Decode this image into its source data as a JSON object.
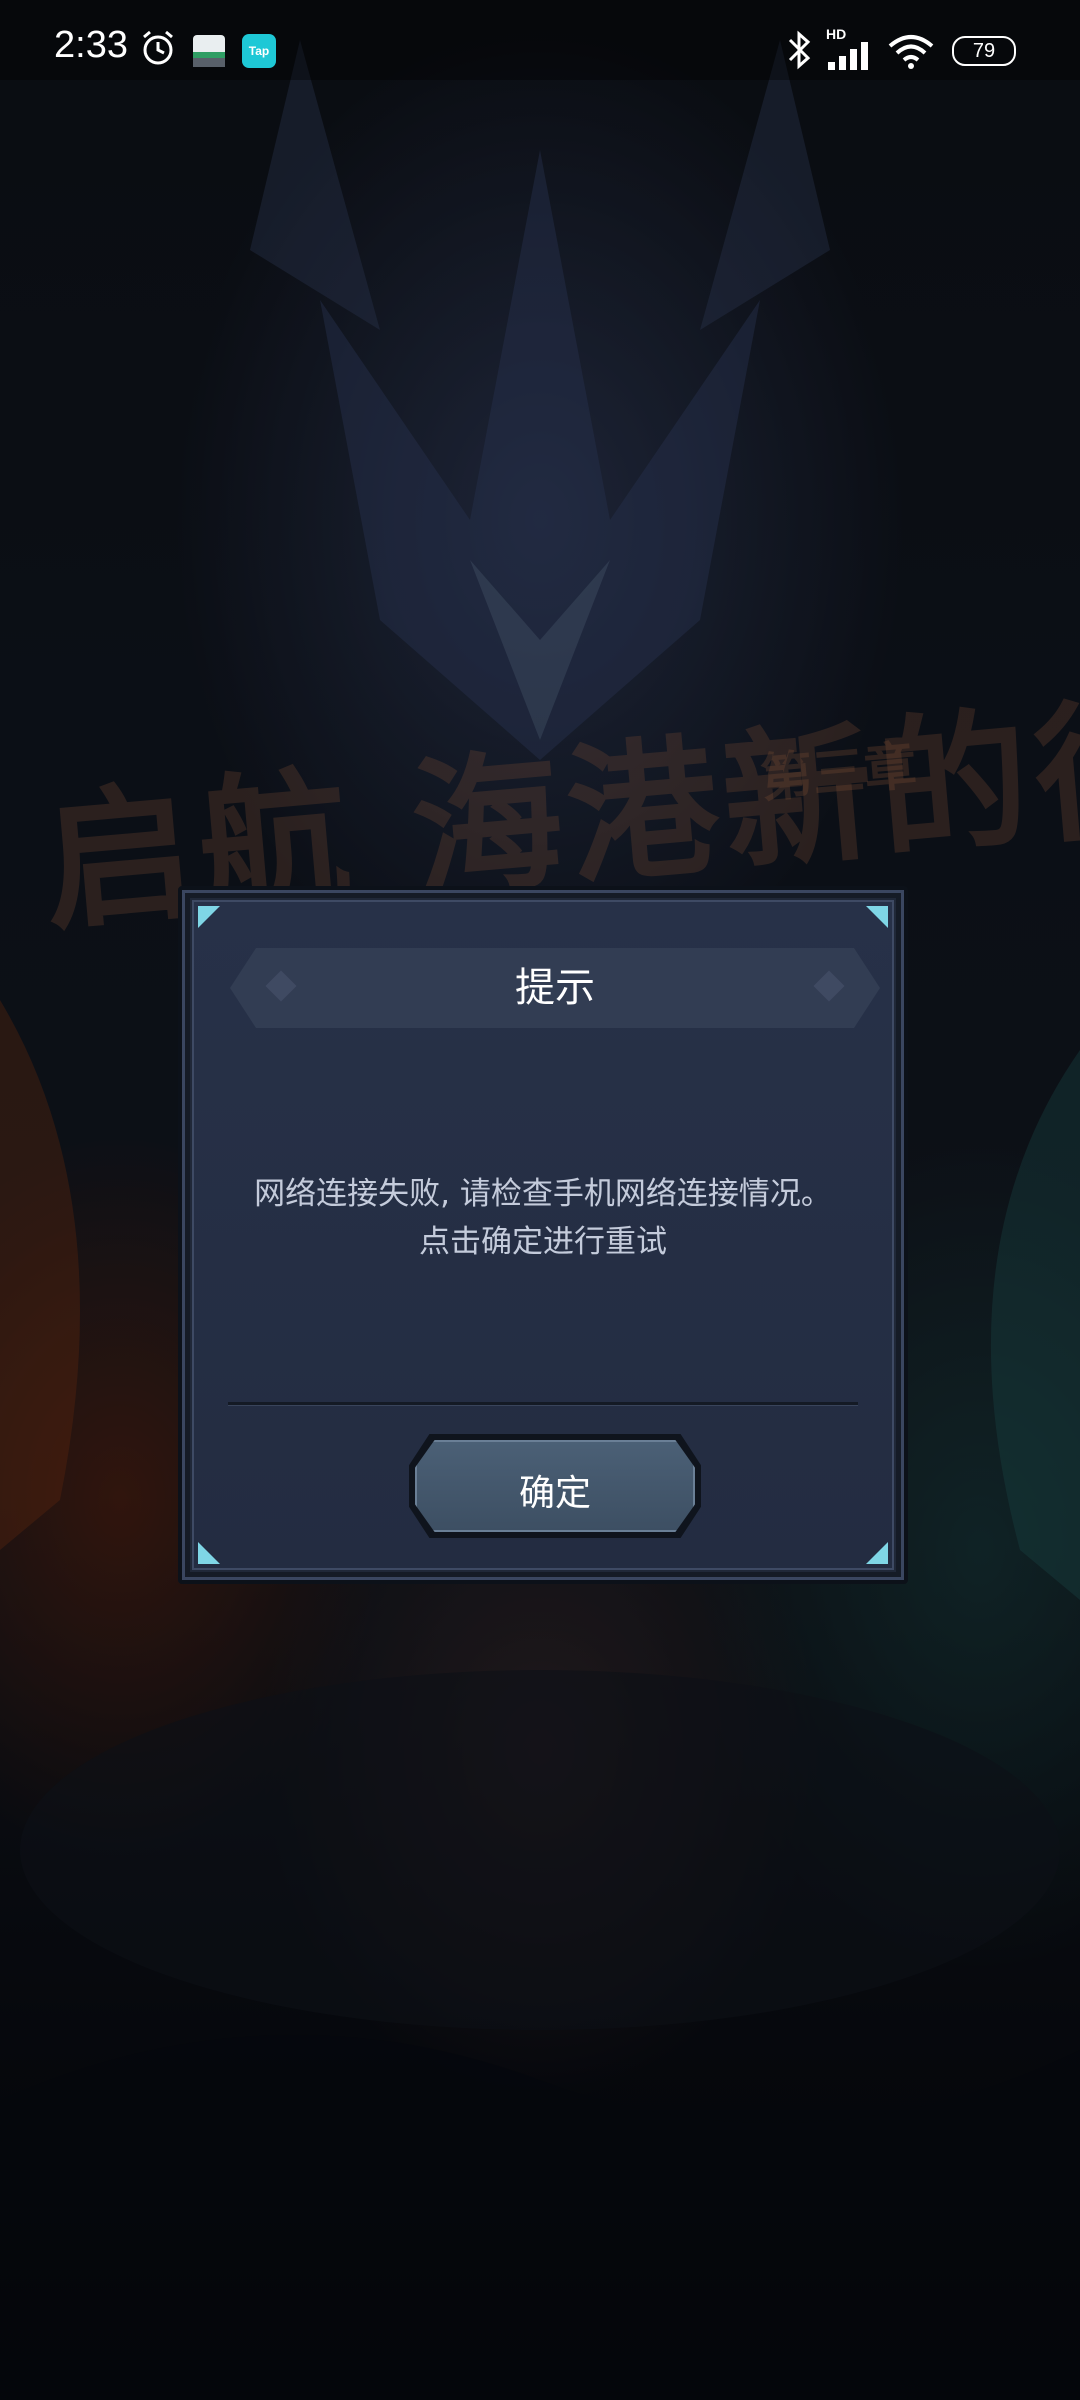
{
  "status_bar": {
    "time": "2:33",
    "battery": "79",
    "network_label": "HD",
    "icons": [
      "alarm-icon",
      "app-notification-icon",
      "tap-app-icon",
      "bluetooth-icon",
      "signal-icon",
      "wifi-icon",
      "battery-icon"
    ],
    "tap_app_text": "Tap"
  },
  "background": {
    "title_text": "启航 海港新的征程",
    "chapter_text": "第三章"
  },
  "dialog": {
    "title": "提示",
    "message_line1": "网络连接失败, 请检查手机网络连接情况。",
    "message_line2": "点击确定进行重试",
    "confirm_label": "确定"
  },
  "colors": {
    "dialog_bg": "#232c41",
    "banner_bg": "#323d53",
    "button_bg": "#435870",
    "text_primary": "#ffffff",
    "text_secondary": "#c4cbdb",
    "corner_accent": "#7fd6e6"
  }
}
